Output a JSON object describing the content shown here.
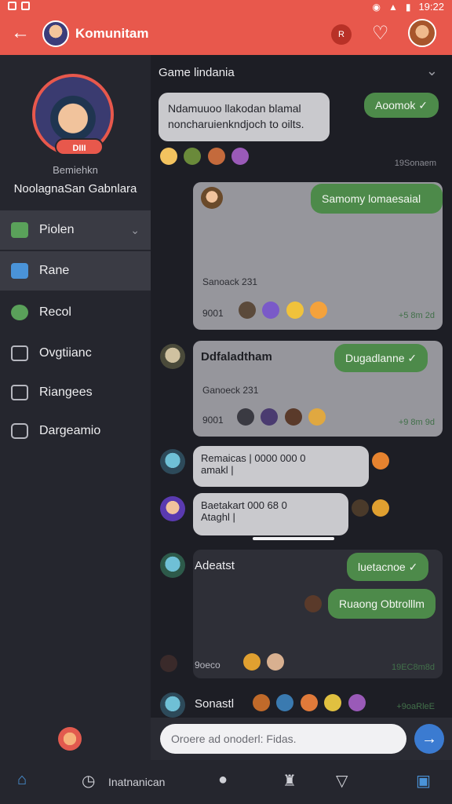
{
  "status_bar": {
    "time": "19:22"
  },
  "app_bar": {
    "back_icon": "arrow-left-icon",
    "title": "Komunitam",
    "chip_label": "R",
    "heart_icon": "heart-icon"
  },
  "sidebar": {
    "profile_badge": "DIII",
    "profile_subtitle": "Bemiehkn",
    "profile_name": "NoolagnaSan Gabnlara",
    "items": [
      {
        "label": "Piolen",
        "icon": "square-green-icon",
        "active": true,
        "chevron": true
      },
      {
        "label": "Rane",
        "icon": "square-blue-icon",
        "active": true
      },
      {
        "label": "Recol",
        "icon": "leaf-green-icon"
      },
      {
        "label": "Ovgtiianc",
        "icon": "box-icon"
      },
      {
        "label": "Riangees",
        "icon": "box-icon"
      },
      {
        "label": "Dargeamio",
        "icon": "camera-icon"
      }
    ]
  },
  "chat": {
    "game_title": "Game lindania",
    "messages": {
      "m1_text": "Ndamuuoo llakodan blamal noncharuienkndjoch to oilts.",
      "m1_reply": "Aoomok ✓",
      "m1_time": "19Sonaem",
      "card1_reply": "Samomy lomaesaial",
      "card1_sub": "Sanoack 231",
      "card1_num": "9001",
      "card1_time": "+5 8m 2d",
      "m2_name": "Ddfaladtham",
      "m2_reply": "Dugadlanne ✓",
      "card2_sub": "Ganoeck 231",
      "card2_num": "9001",
      "card2_time": "+9 8m 9d",
      "m3_text": "Remaicas | 0000 000 0",
      "m3_sub": "amakl |",
      "m4_text": "Baetakart 000 68 0",
      "m4_sub": "Ataghl |",
      "m5_name": "Adeatst",
      "m5_reply1": "luetacnoe ✓",
      "m5_reply2": "Ruaong Obtrolllm",
      "m5_num": "9oeco",
      "m5_time": "19EC8m8d",
      "m6_name": "Sonastl",
      "m6_time": "+9oaRleE"
    },
    "input_placeholder": "Oroere ad onoderl: Fidas."
  },
  "bottom_nav": {
    "label": "Inatnanican"
  },
  "colors": {
    "accent": "#e8584c",
    "green": "#4d8a4a",
    "blue": "#3b7bd1"
  }
}
